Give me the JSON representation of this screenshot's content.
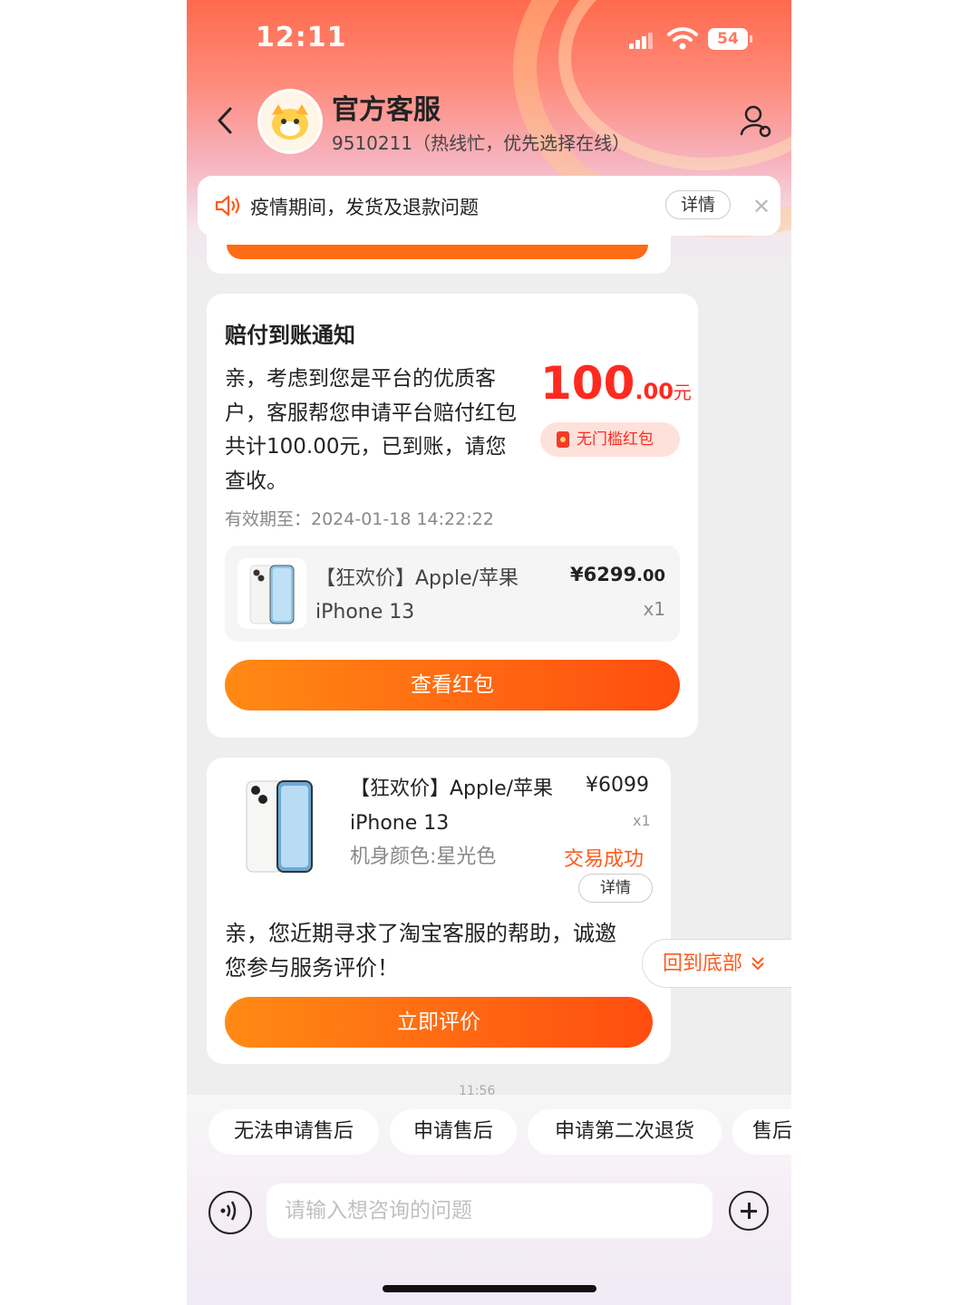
{
  "status_bar": {
    "time": "12:11",
    "battery": "54"
  },
  "header": {
    "title": "官方客服",
    "subtitle": "9510211（热线忙，优先选择在线）"
  },
  "notice": {
    "text": "疫情期间，发货及退款问题",
    "detail_label": "详情",
    "close": "✕"
  },
  "compensation_card": {
    "heading": "赔付到账通知",
    "body": "亲，考虑到您是平台的优质客户，客服帮您申请平台赔付红包共计100.00元，已到账，请您查收。",
    "valid_until": "有效期至：2024-01-18 14:22:22",
    "amount_int": "100",
    "amount_dec": ".00",
    "amount_unit": "元",
    "tag": "无门槛红包",
    "product": {
      "name": "【狂欢价】Apple/苹果 iPhone 13",
      "price_int": "¥6299",
      "price_dec": ".00",
      "qty": "x1"
    },
    "button": "查看红包"
  },
  "order_card": {
    "product_name": "【狂欢价】Apple/苹果 iPhone 13",
    "spec": "机身颜色:星光色",
    "price": "¥6099",
    "qty": "x1",
    "status": "交易成功",
    "detail_label": "详情",
    "message": "亲，您近期寻求了淘宝客服的帮助，诚邀您参与服务评价！",
    "button": "立即评价"
  },
  "back_to_bottom": "回到底部",
  "timestamp": "11:56",
  "quick_replies": [
    "无法申请售后",
    "申请售后",
    "申请第二次退货",
    "售后"
  ],
  "input": {
    "placeholder": "请输入想咨询的问题"
  },
  "icons": [
    "back-arrow-icon",
    "avatar",
    "user-settings-icon",
    "speaker-icon",
    "close-icon",
    "voice-icon",
    "plus-icon",
    "chevron-down-icon"
  ],
  "colors": {
    "accent": "#ff5a1a",
    "price_red": "#ff2a1f",
    "button_gradient_start": "#ff8a14",
    "button_gradient_end": "#ff4d10"
  }
}
